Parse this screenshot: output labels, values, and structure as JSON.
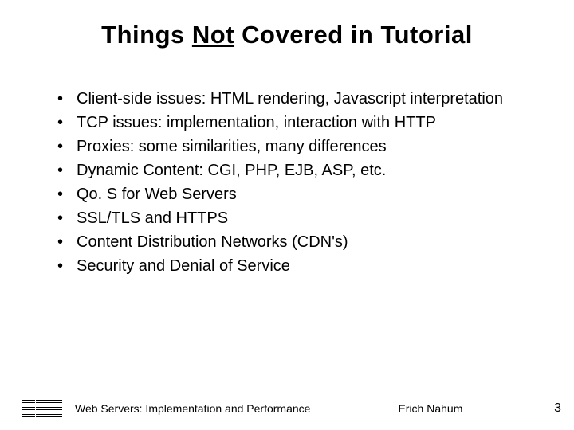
{
  "title": {
    "pre": "Things ",
    "underlined": "Not",
    "post": " Covered in Tutorial"
  },
  "bullets": [
    "Client-side issues: HTML rendering, Javascript interpretation",
    "TCP issues: implementation, interaction with HTTP",
    "Proxies: some similarities, many differences",
    "Dynamic Content: CGI, PHP, EJB, ASP, etc.",
    "Qo. S for Web Servers",
    "SSL/TLS and HTTPS",
    "Content Distribution Networks (CDN's)",
    "Security and Denial of Service"
  ],
  "footer": {
    "text": "Web Servers: Implementation and Performance",
    "author": "Erich Nahum",
    "page": "3"
  }
}
